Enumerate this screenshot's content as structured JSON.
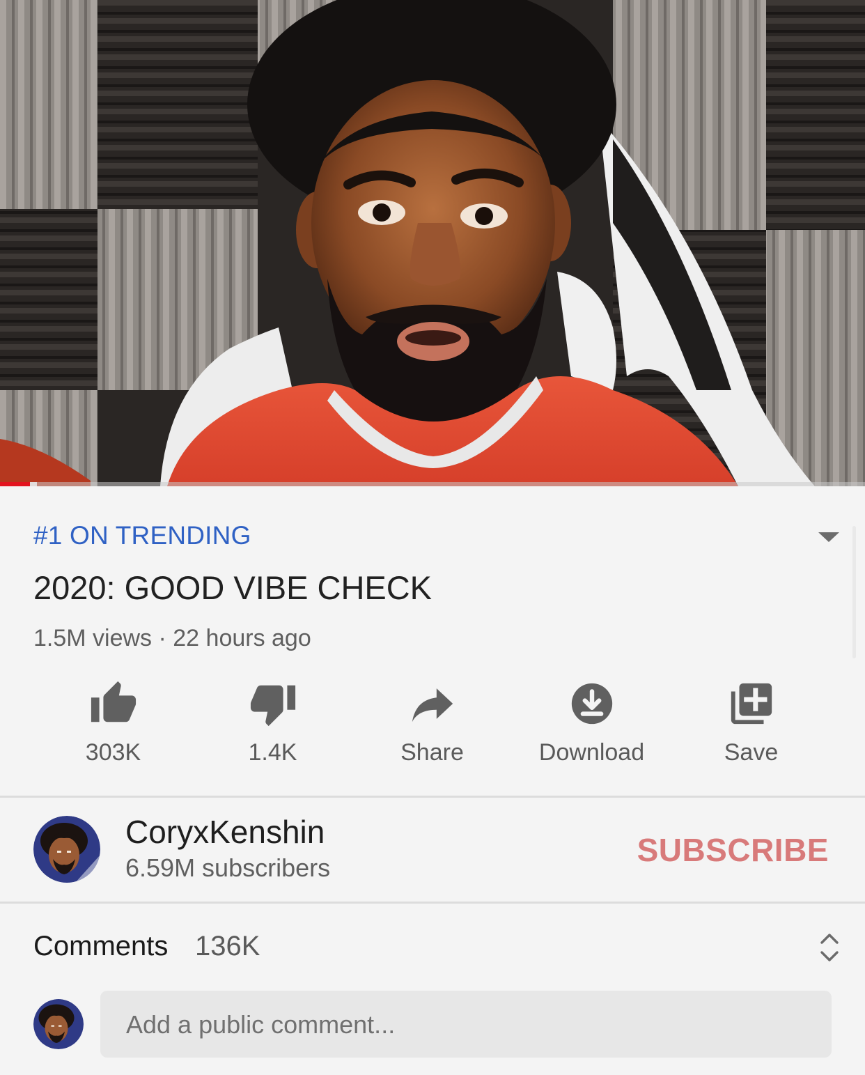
{
  "video": {
    "progress_fraction": 0.035,
    "buffer_fraction": 0.043
  },
  "info": {
    "trending_badge": "#1 ON TRENDING",
    "title": "2020: GOOD VIBE CHECK",
    "meta": "1.5M views · 22 hours ago"
  },
  "actions": {
    "like_count": "303K",
    "dislike_count": "1.4K",
    "share_label": "Share",
    "download_label": "Download",
    "save_label": "Save"
  },
  "channel": {
    "name": "CoryxKenshin",
    "subscribers": "6.59M subscribers",
    "subscribe_label": "SUBSCRIBE"
  },
  "comments": {
    "label": "Comments",
    "count": "136K",
    "placeholder": "Add a public comment..."
  },
  "colors": {
    "accent_blue": "#2f61c4",
    "subscribe_red": "#d87a7a",
    "progress_red": "#e3141f",
    "icon_gray": "#606060"
  },
  "icons": [
    "thumbs-up-icon",
    "thumbs-down-icon",
    "share-icon",
    "download-icon",
    "save-playlist-icon",
    "collapse-caret-icon",
    "expand-collapse-icon"
  ]
}
